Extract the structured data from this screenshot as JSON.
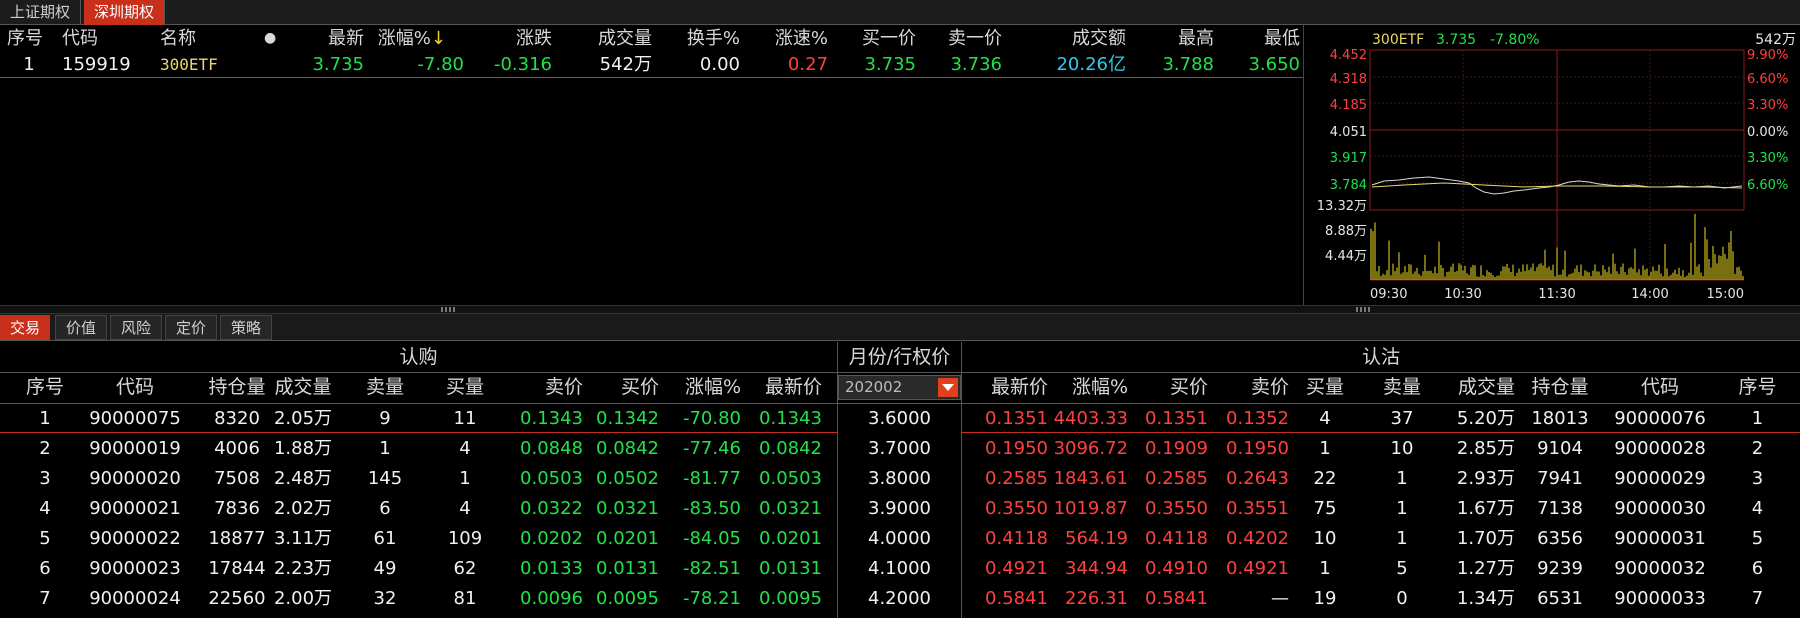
{
  "top_tabs": [
    "上证期权",
    "深圳期权"
  ],
  "quote": {
    "headers": [
      "序号",
      "代码",
      "名称",
      "●",
      "最新",
      "涨幅%",
      "涨跌",
      "成交量",
      "换手%",
      "涨速%",
      "买一价",
      "卖一价",
      "成交额",
      "最高",
      "最低"
    ],
    "sort_arrow": "↓",
    "row": {
      "idx": "1",
      "code": "159919",
      "name": "300ETF",
      "last": "3.735",
      "pct": "-7.80",
      "chg": "-0.316",
      "vol": "542万",
      "turnover": "0.00",
      "speed": "0.27",
      "bid1": "3.735",
      "ask1": "3.736",
      "amount": "20.26",
      "amount_unit": "亿",
      "high": "3.788",
      "low": "3.650"
    }
  },
  "mini_chart": {
    "name": "300ETF",
    "price": "3.735",
    "pct": "-7.80%",
    "vol_total": "542万",
    "left_axis": [
      "4.452",
      "4.318",
      "4.185",
      "4.051",
      "3.917",
      "3.784"
    ],
    "right_axis": [
      "9.90%",
      "6.60%",
      "3.30%",
      "0.00%",
      "3.30%",
      "6.60%"
    ],
    "vol_axis": [
      "13.32万",
      "8.88万",
      "4.44万"
    ],
    "time_axis": [
      "09:30",
      "10:30",
      "11:30",
      "14:00",
      "15:00"
    ]
  },
  "sub_tabs": [
    "交易",
    "价值",
    "风险",
    "定价",
    "策略"
  ],
  "board": {
    "call_title": "认购",
    "middle_title": "月份/行权价",
    "put_title": "认沽",
    "month": "202002",
    "call_headers": [
      "序号",
      "代码",
      "持仓量",
      "成交量",
      "卖量",
      "买量",
      "卖价",
      "买价",
      "涨幅%",
      "最新价"
    ],
    "put_headers": [
      "最新价",
      "涨幅%",
      "买价",
      "卖价",
      "买量",
      "卖量",
      "成交量",
      "持仓量",
      "代码",
      "序号"
    ],
    "rows": [
      {
        "call": [
          "1",
          "90000075",
          "8320",
          "2.05万",
          "9",
          "11",
          "0.1343",
          "0.1342",
          "-70.80",
          "0.1343"
        ],
        "strike": "3.6000",
        "put": [
          "0.1351",
          "4403.33",
          "0.1351",
          "0.1352",
          "4",
          "37",
          "5.20万",
          "18013",
          "90000076",
          "1"
        ]
      },
      {
        "call": [
          "2",
          "90000019",
          "4006",
          "1.88万",
          "1",
          "4",
          "0.0848",
          "0.0842",
          "-77.46",
          "0.0842"
        ],
        "strike": "3.7000",
        "put": [
          "0.1950",
          "3096.72",
          "0.1909",
          "0.1950",
          "1",
          "10",
          "2.85万",
          "9104",
          "90000028",
          "2"
        ]
      },
      {
        "call": [
          "3",
          "90000020",
          "7508",
          "2.48万",
          "145",
          "1",
          "0.0503",
          "0.0502",
          "-81.77",
          "0.0503"
        ],
        "strike": "3.8000",
        "put": [
          "0.2585",
          "1843.61",
          "0.2585",
          "0.2643",
          "22",
          "1",
          "2.93万",
          "7941",
          "90000029",
          "3"
        ]
      },
      {
        "call": [
          "4",
          "90000021",
          "7836",
          "2.02万",
          "6",
          "4",
          "0.0322",
          "0.0321",
          "-83.50",
          "0.0321"
        ],
        "strike": "3.9000",
        "put": [
          "0.3550",
          "1019.87",
          "0.3550",
          "0.3551",
          "75",
          "1",
          "1.67万",
          "7138",
          "90000030",
          "4"
        ]
      },
      {
        "call": [
          "5",
          "90000022",
          "18877",
          "3.11万",
          "61",
          "109",
          "0.0202",
          "0.0201",
          "-84.05",
          "0.0201"
        ],
        "strike": "4.0000",
        "put": [
          "0.4118",
          "564.19",
          "0.4118",
          "0.4202",
          "10",
          "1",
          "1.70万",
          "6356",
          "90000031",
          "5"
        ]
      },
      {
        "call": [
          "6",
          "90000023",
          "17844",
          "2.23万",
          "49",
          "62",
          "0.0133",
          "0.0131",
          "-82.51",
          "0.0131"
        ],
        "strike": "4.1000",
        "put": [
          "0.4921",
          "344.94",
          "0.4910",
          "0.4921",
          "1",
          "5",
          "1.27万",
          "9239",
          "90000032",
          "6"
        ]
      },
      {
        "call": [
          "7",
          "90000024",
          "22560",
          "2.00万",
          "32",
          "81",
          "0.0096",
          "0.0095",
          "-78.21",
          "0.0095"
        ],
        "strike": "4.2000",
        "put": [
          "0.5841",
          "226.31",
          "0.5841",
          "—",
          "19",
          "0",
          "1.34万",
          "6531",
          "90000033",
          "7"
        ]
      }
    ]
  },
  "colors": {
    "accent": "#c9301c",
    "up": "#ff4040",
    "down": "#22e04a",
    "amount": "#31c9e8",
    "volume_bar": "#f0e020",
    "avg_line": "#e8d86a"
  }
}
